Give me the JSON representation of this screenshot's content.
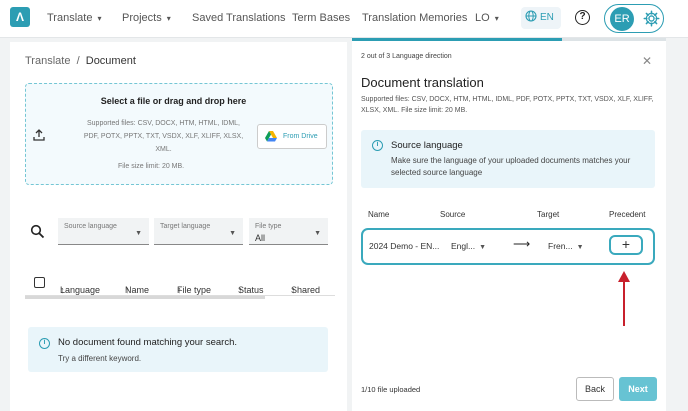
{
  "nav": {
    "items": [
      "Translate",
      "Projects",
      "Saved Translations",
      "Term Bases",
      "Translation Memories",
      "LO"
    ],
    "language": "EN",
    "avatar_initials": "ER",
    "progress_fraction": 0.67
  },
  "left": {
    "breadcrumb": [
      "Translate",
      "Document"
    ],
    "dropzone": {
      "title": "Select a file or drag and drop here",
      "supported": "Supported files: CSV, DOCX, HTM, HTML, IDML, PDF, POTX, PPTX, TXT, VSDX, XLF, XLIFF, XLSX, XML.",
      "limit": "File size limit: 20 MB.",
      "drive_label": "From Drive"
    },
    "filters": {
      "source_language": "Source language",
      "target_language": "Target language",
      "file_type_label": "File type",
      "file_type_value": "All"
    },
    "table_headers": [
      "Language",
      "Name",
      "File type",
      "Status",
      "Shared"
    ],
    "empty": {
      "title": "No document found matching your search.",
      "subtitle": "Try a different keyword."
    }
  },
  "right": {
    "step": "2 out of 3 Language direction",
    "title": "Document translation",
    "supported": "Supported files: CSV, DOCX, HTM, HTML, IDML, PDF, POTX, PPTX, TXT, VSDX, XLF, XLIFF, XLSX, XML. File size limit: 20 MB.",
    "source_box": {
      "title": "Source language",
      "text": "Make sure the language of your uploaded documents matches your selected source language"
    },
    "headers": [
      "Name",
      "Source",
      "Target",
      "Precedent"
    ],
    "row": {
      "name": "2024 Demo - EN...",
      "source": "Engl...",
      "target": "Fren..."
    },
    "file_count": "1/10 file uploaded",
    "back": "Back",
    "next": "Next"
  },
  "colors": {
    "accent": "#2c9db3",
    "annotation": "#c8202c"
  }
}
